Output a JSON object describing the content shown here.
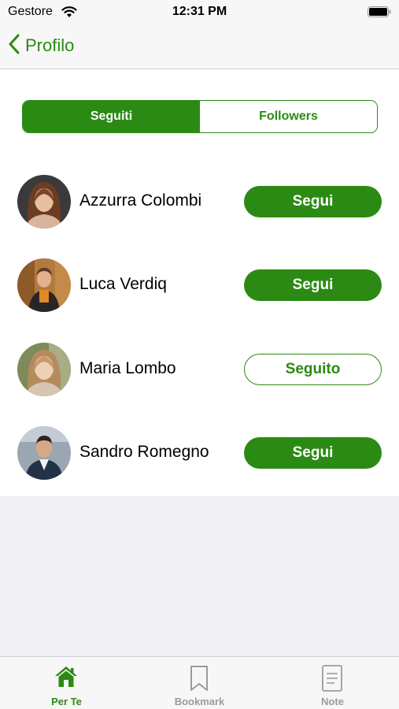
{
  "status_bar": {
    "carrier": "Gestore",
    "time": "12:31 PM"
  },
  "nav": {
    "back_label": "Profilo"
  },
  "segment": {
    "options": [
      "Seguiti",
      "Followers"
    ],
    "selected": "Seguiti"
  },
  "users": [
    {
      "name": "Azzurra Colombi",
      "action": "Segui",
      "following": false
    },
    {
      "name": "Luca Verdiq",
      "action": "Segui",
      "following": false
    },
    {
      "name": "Maria Lombo",
      "action": "Seguito",
      "following": true
    },
    {
      "name": "Sandro Romegno",
      "action": "Segui",
      "following": false
    }
  ],
  "tabs": [
    {
      "label": "Per Te",
      "icon": "home-icon",
      "active": true
    },
    {
      "label": "Bookmark",
      "icon": "bookmark-icon",
      "active": false
    },
    {
      "label": "Note",
      "icon": "note-icon",
      "active": false
    }
  ],
  "colors": {
    "accent": "#2b8a13",
    "inactive": "#9b9b9b"
  }
}
